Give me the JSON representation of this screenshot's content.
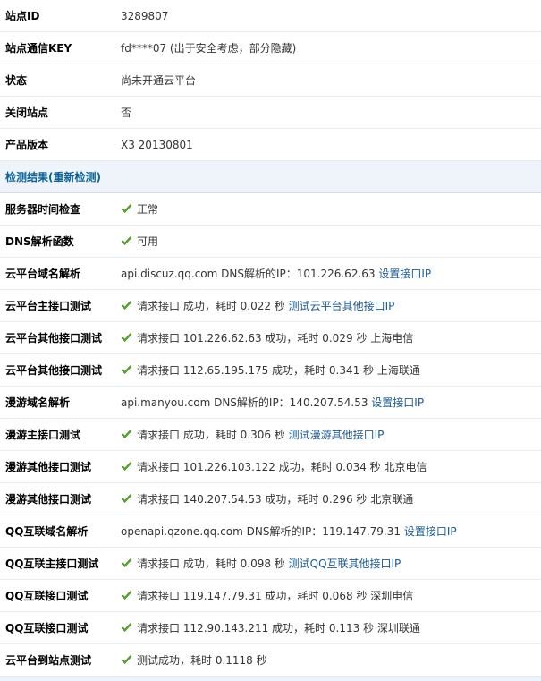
{
  "info": [
    {
      "label": "站点ID",
      "value": "3289807"
    },
    {
      "label": "站点通信KEY",
      "value": "fd****07 (出于安全考虑，部分隐藏)"
    },
    {
      "label": "状态",
      "value": "尚未开通云平台"
    },
    {
      "label": "关闭站点",
      "value": "否"
    },
    {
      "label": "产品版本",
      "value": "X3 20130801"
    }
  ],
  "section": {
    "title": "检测结果(",
    "link": "重新检测",
    "close": ")"
  },
  "checks": [
    {
      "label": "服务器时间检查",
      "icon": "check-icon",
      "text": "正常",
      "link": ""
    },
    {
      "label": "DNS解析函数",
      "icon": "check-icon",
      "text": "可用",
      "link": ""
    },
    {
      "label": "云平台域名解析",
      "icon": "",
      "text": "api.discuz.qq.com DNS解析的IP：101.226.62.63 ",
      "link": "设置接口IP"
    },
    {
      "label": "云平台主接口测试",
      "icon": "check-icon",
      "text": "请求接口 成功，耗时 0.022 秒 ",
      "link": "测试云平台其他接口IP"
    },
    {
      "label": "云平台其他接口测试",
      "icon": "check-icon",
      "text": "请求接口 101.226.62.63 成功，耗时 0.029 秒 上海电信",
      "link": ""
    },
    {
      "label": "云平台其他接口测试",
      "icon": "check-icon",
      "text": "请求接口 112.65.195.175 成功，耗时 0.341 秒 上海联通",
      "link": ""
    },
    {
      "label": "漫游域名解析",
      "icon": "",
      "text": "api.manyou.com DNS解析的IP：140.207.54.53 ",
      "link": "设置接口IP"
    },
    {
      "label": "漫游主接口测试",
      "icon": "check-icon",
      "text": "请求接口 成功，耗时 0.306 秒 ",
      "link": "测试漫游其他接口IP"
    },
    {
      "label": "漫游其他接口测试",
      "icon": "check-icon",
      "text": "请求接口 101.226.103.122 成功，耗时 0.034 秒 北京电信",
      "link": ""
    },
    {
      "label": "漫游其他接口测试",
      "icon": "check-icon",
      "text": "请求接口 140.207.54.53 成功，耗时 0.296 秒 北京联通",
      "link": ""
    },
    {
      "label": "QQ互联域名解析",
      "icon": "",
      "text": "openapi.qzone.qq.com DNS解析的IP：119.147.79.31 ",
      "link": "设置接口IP"
    },
    {
      "label": "QQ互联主接口测试",
      "icon": "check-icon",
      "text": "请求接口 成功，耗时 0.098 秒 ",
      "link": "测试QQ互联其他接口IP"
    },
    {
      "label": "QQ互联接口测试",
      "icon": "check-icon",
      "text": "请求接口 119.147.79.31 成功，耗时 0.068 秒 深圳电信",
      "link": ""
    },
    {
      "label": "QQ互联接口测试",
      "icon": "check-icon",
      "text": "请求接口 112.90.143.211 成功，耗时 0.113 秒 深圳联通",
      "link": ""
    },
    {
      "label": "云平台到站点测试",
      "icon": "check-icon",
      "text": "测试成功，耗时 0.1118 秒",
      "link": ""
    }
  ]
}
